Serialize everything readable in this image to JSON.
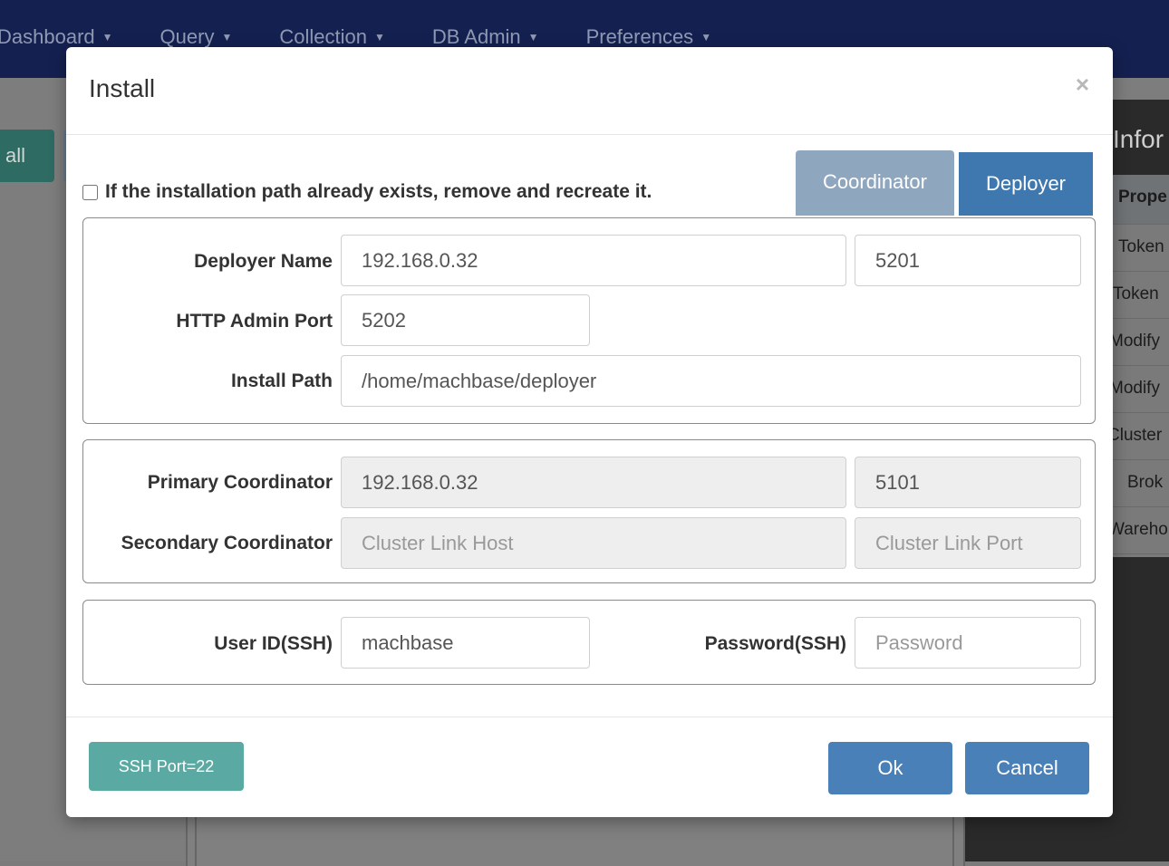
{
  "navbar": {
    "items": [
      {
        "label": "Dashboard"
      },
      {
        "label": "Query"
      },
      {
        "label": "Collection"
      },
      {
        "label": "DB Admin"
      },
      {
        "label": "Preferences"
      }
    ]
  },
  "background": {
    "left_button_label": "all",
    "right_panel_title": "Infor",
    "table_header": "Prope",
    "table_rows": [
      "Token",
      "Token",
      "Modify",
      "Modify",
      "Cluster",
      "Brok",
      "Wareho"
    ]
  },
  "modal": {
    "title": "Install",
    "close": "×",
    "recreate_label": "If the installation path already exists, remove and recreate it.",
    "recreate_checked": false,
    "tabs": [
      {
        "label": "Coordinator",
        "active": false
      },
      {
        "label": "Deployer",
        "active": true
      }
    ],
    "deployer": {
      "name_label": "Deployer Name",
      "name_host": "192.168.0.32",
      "name_port": "5201",
      "http_admin_port_label": "HTTP Admin Port",
      "http_admin_port": "5202",
      "install_path_label": "Install Path",
      "install_path": "/home/machbase/deployer"
    },
    "coordinators": {
      "primary_label": "Primary Coordinator",
      "primary_host": "192.168.0.32",
      "primary_port": "5101",
      "secondary_label": "Secondary Coordinator",
      "secondary_host_placeholder": "Cluster Link Host",
      "secondary_port_placeholder": "Cluster Link Port"
    },
    "ssh": {
      "user_label": "User ID(SSH)",
      "user": "machbase",
      "password_label": "Password(SSH)",
      "password_placeholder": "Password"
    },
    "footer": {
      "ssh_port_button": "SSH Port=22",
      "ok_button": "Ok",
      "cancel_button": "Cancel"
    }
  },
  "colors": {
    "navbar_bg": "#142050",
    "tab_active": "#3f78ae",
    "tab_inactive": "#8ea6be",
    "primary_button": "#4a80b8",
    "ssh_button": "#5aa9a2"
  }
}
